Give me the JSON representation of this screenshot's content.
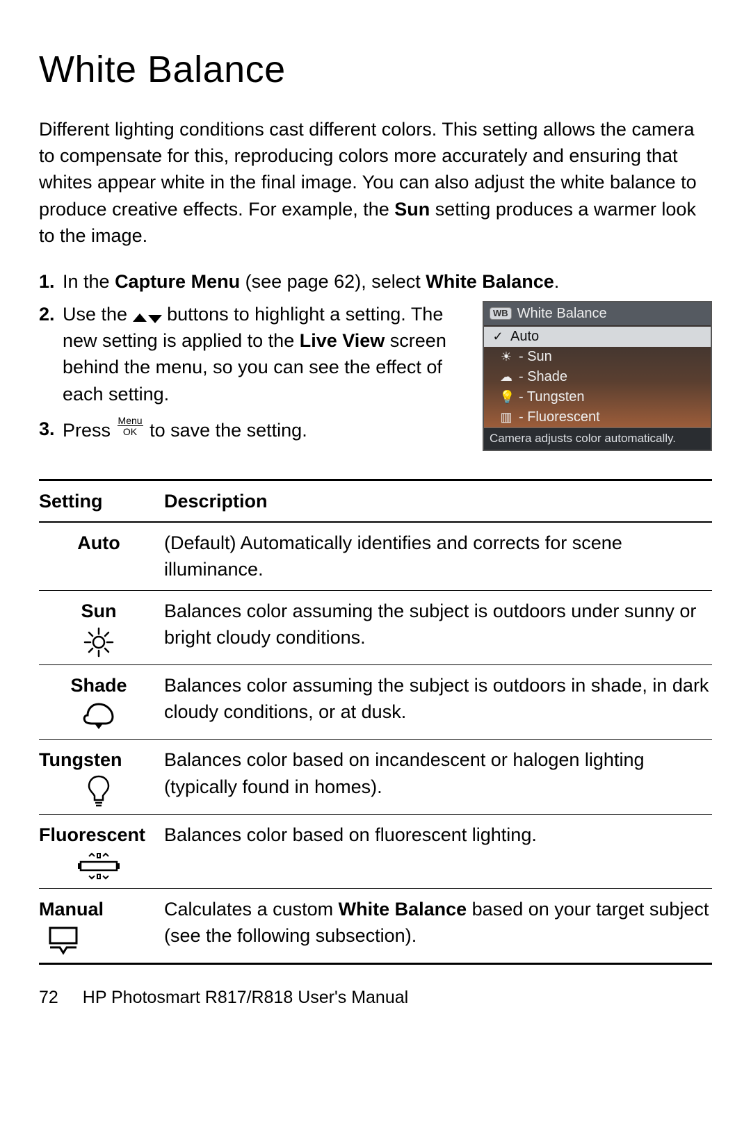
{
  "title": "White Balance",
  "intro_pre": "Different lighting conditions cast different colors. This setting allows the camera to compensate for this, reproducing colors more accurately and ensuring that whites appear white in the final image. You can also adjust the white balance to produce creative effects. For example, the ",
  "intro_bold": "Sun",
  "intro_post": " setting produces a warmer look to the image.",
  "step1": {
    "num": "1.",
    "a": "In the ",
    "b1": "Capture Menu",
    "c": " (see page 62), select ",
    "b2": "White Balance",
    "d": "."
  },
  "step2": {
    "num": "2.",
    "a": "Use the ",
    "b": " buttons to highlight a setting. The new setting is applied to the ",
    "bold": "Live View",
    "c": " screen behind the menu, so you can see the effect of each setting."
  },
  "step3": {
    "num": "3.",
    "a": "Press ",
    "b": " to save the setting."
  },
  "screenshot": {
    "title": "White Balance",
    "badge": "WB",
    "items": {
      "auto": "Auto",
      "sun": "- Sun",
      "shade": "- Shade",
      "tungsten": "- Tungsten",
      "fluorescent": "- Fluorescent"
    },
    "footer": "Camera adjusts color automatically."
  },
  "table": {
    "h1": "Setting",
    "h2": "Description",
    "auto_label": "Auto",
    "auto_desc": "(Default) Automatically identifies and corrects for scene illuminance.",
    "sun_label": "Sun",
    "sun_desc": "Balances color assuming the subject is outdoors under sunny or bright cloudy conditions.",
    "shade_label": "Shade",
    "shade_desc": "Balances color assuming the subject is outdoors in shade, in dark cloudy conditions, or at dusk.",
    "tungsten_label": "Tungsten",
    "tungsten_desc": "Balances color based on incandescent or halogen lighting (typically found in homes).",
    "fluorescent_label": "Fluorescent",
    "fluorescent_desc": "Balances color based on fluorescent lighting.",
    "manual_label": "Manual",
    "manual_desc_a": "Calculates a custom ",
    "manual_desc_b": "White Balance",
    "manual_desc_c": " based on your target subject (see the following subsection)."
  },
  "footer": {
    "page": "72",
    "book": "HP Photosmart R817/R818 User's Manual"
  },
  "menuok": {
    "top": "Menu",
    "bot": "OK"
  },
  "check": "✓"
}
